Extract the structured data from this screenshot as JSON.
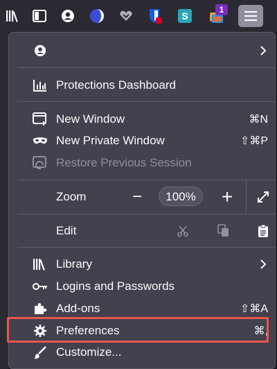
{
  "toolbar": {
    "icons": [
      "library-icon",
      "sidebar-icon",
      "account-icon",
      "extension-icon",
      "pocket-icon",
      "bitwarden-icon",
      "stylus-icon",
      "tab-stack-icon"
    ],
    "badge_count": "1"
  },
  "menu": {
    "account": {
      "icon": "account-icon"
    },
    "protections": {
      "label": "Protections Dashboard"
    },
    "new_window": {
      "label": "New Window",
      "shortcut": "⌘N"
    },
    "new_private_window": {
      "label": "New Private Window",
      "shortcut": "⇧⌘P"
    },
    "restore_session": {
      "label": "Restore Previous Session",
      "enabled": false
    },
    "zoom": {
      "label": "Zoom",
      "minus": "−",
      "value": "100%",
      "plus": "+"
    },
    "edit": {
      "label": "Edit"
    },
    "library": {
      "label": "Library"
    },
    "logins": {
      "label": "Logins and Passwords"
    },
    "addons": {
      "label": "Add-ons",
      "shortcut": "⇧⌘A"
    },
    "preferences": {
      "label": "Preferences",
      "shortcut": "⌘,"
    },
    "customize": {
      "label": "Customize..."
    }
  },
  "colors": {
    "menu_bg": "#42414d",
    "toolbar_bg": "#2b2a33",
    "highlight": "#e8574e",
    "text": "#fbfbfe",
    "disabled_text": "#8f8f9d"
  }
}
